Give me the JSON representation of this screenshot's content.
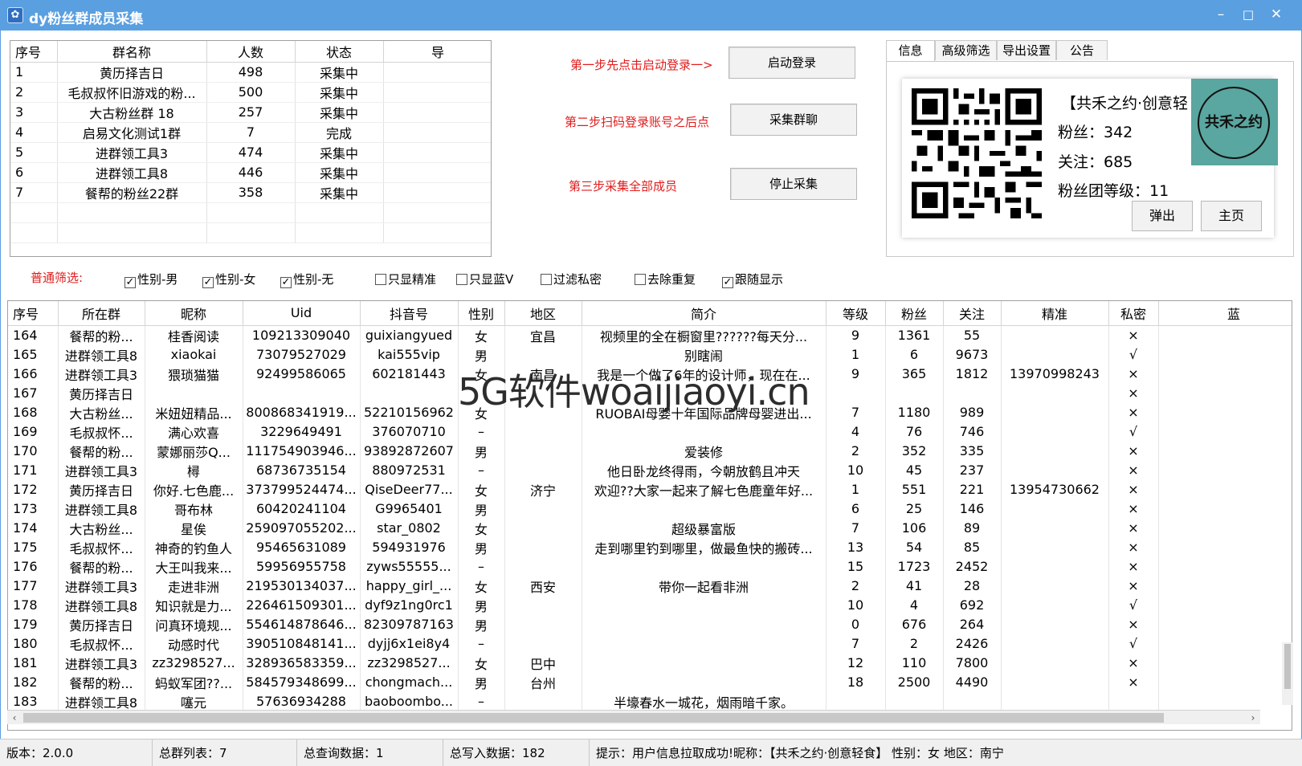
{
  "window": {
    "title": "dy粉丝群成员采集",
    "minimize": "–",
    "maximize": "□",
    "close": "✕"
  },
  "group_table": {
    "columns": [
      "序号",
      "群名称",
      "人数",
      "状态",
      "导"
    ],
    "rows": [
      [
        "1",
        "黄历择吉日",
        "498",
        "采集中"
      ],
      [
        "2",
        "毛叔叔怀旧游戏的粉...",
        "500",
        "采集中"
      ],
      [
        "3",
        "大古粉丝群 18",
        "257",
        "采集中"
      ],
      [
        "4",
        "启易文化测试1群",
        "7",
        "完成"
      ],
      [
        "5",
        "进群领工具3",
        "474",
        "采集中"
      ],
      [
        "6",
        "进群领工具8",
        "446",
        "采集中"
      ],
      [
        "7",
        "餐帮的粉丝22群",
        "358",
        "采集中"
      ]
    ]
  },
  "steps": {
    "step1_label": "第一步先点击启动登录一>",
    "step1_button": "启动登录",
    "step2_label": "第二步扫码登录账号之后点",
    "step2_button": "采集群聊",
    "step3_label": "第三步采集全部成员",
    "step3_button": "停止采集"
  },
  "info_panel": {
    "tabs": [
      "信息",
      "高级筛选",
      "导出设置",
      "公告"
    ],
    "name": "【共禾之约·创意轻",
    "fans": "粉丝：342",
    "following": "关注：685",
    "fan_level": "粉丝团等级：11",
    "logo_text": "共禾之约",
    "eject_button": "弹出",
    "home_button": "主页"
  },
  "filters": {
    "label": "普通筛选:",
    "items": [
      {
        "label": "性别-男",
        "checked": true
      },
      {
        "label": "性别-女",
        "checked": true
      },
      {
        "label": "性别-无",
        "checked": true
      },
      {
        "label": "只显精准",
        "checked": false
      },
      {
        "label": "只显蓝V",
        "checked": false
      },
      {
        "label": "过滤私密",
        "checked": false
      },
      {
        "label": "去除重复",
        "checked": false
      },
      {
        "label": "跟随显示",
        "checked": true
      }
    ]
  },
  "member_table": {
    "columns": [
      "序号",
      "所在群",
      "昵称",
      "Uid",
      "抖音号",
      "性别",
      "地区",
      "简介",
      "等级",
      "粉丝",
      "关注",
      "精准",
      "私密",
      "蓝"
    ],
    "rows": [
      [
        "164",
        "餐帮的粉...",
        "桂香阅读",
        "109213309040",
        "guixiangyued",
        "女",
        "宜昌",
        "视频里的全在橱窗里??????每天分...",
        "9",
        "1361",
        "55",
        "",
        "×"
      ],
      [
        "165",
        "进群领工具8",
        "xiaokai",
        "73079527029",
        "kai555vip",
        "男",
        "",
        "别瞎闹",
        "1",
        "6",
        "9673",
        "",
        "√"
      ],
      [
        "166",
        "进群领工具3",
        "猥琐猫猫",
        "92499586065",
        "602181443",
        "女",
        "南昌",
        "我是一个做了6年的设计师，现在在...",
        "9",
        "365",
        "1812",
        "13970998243",
        "×"
      ],
      [
        "167",
        "黄历择吉日",
        "",
        "",
        "",
        "",
        "",
        "",
        "",
        "",
        "",
        "",
        "×"
      ],
      [
        "168",
        "大古粉丝...",
        "米妞妞精品...",
        "800868341919...",
        "52210156962",
        "女",
        "",
        "RUOBAI母婴十年国际品牌母婴进出...",
        "7",
        "1180",
        "989",
        "",
        "×"
      ],
      [
        "169",
        "毛叔叔怀...",
        "满心欢喜",
        "3229649491",
        "376070710",
        "–",
        "",
        "",
        "4",
        "76",
        "746",
        "",
        "√"
      ],
      [
        "170",
        "餐帮的粉...",
        "蒙娜丽莎Q...",
        "111754903946...",
        "93892872607",
        "男",
        "",
        "爱装修",
        "2",
        "352",
        "335",
        "",
        "×"
      ],
      [
        "171",
        "进群领工具3",
        "樳",
        "68736735154",
        "880972531",
        "–",
        "",
        "他日卧龙终得雨，今朝放鹤且冲天",
        "10",
        "45",
        "237",
        "",
        "×"
      ],
      [
        "172",
        "黄历择吉日",
        "你好.七色鹿...",
        "373799524474...",
        "QiseDeer77...",
        "女",
        "济宁",
        "欢迎??大家一起来了解七色鹿童年好...",
        "1",
        "551",
        "221",
        "13954730662",
        "×"
      ],
      [
        "173",
        "进群领工具8",
        "哥布林",
        "60420241104",
        "G9965401",
        "男",
        "",
        "",
        "6",
        "25",
        "146",
        "",
        "×"
      ],
      [
        "174",
        "大古粉丝...",
        "星俟",
        "259097055202...",
        "star_0802",
        "女",
        "",
        "超级暴富版",
        "7",
        "106",
        "89",
        "",
        "×"
      ],
      [
        "175",
        "毛叔叔怀...",
        "神奇的钓鱼人",
        "95465631089",
        "594931976",
        "男",
        "",
        "走到哪里钓到哪里，做最鱼快的搬砖...",
        "13",
        "54",
        "85",
        "",
        "×"
      ],
      [
        "176",
        "餐帮的粉...",
        "大王叫我来...",
        "59956955758",
        "zyws55555...",
        "–",
        "",
        "",
        "15",
        "1723",
        "2452",
        "",
        "×"
      ],
      [
        "177",
        "进群领工具3",
        "走进非洲",
        "219530134037...",
        "happy_girl_...",
        "女",
        "西安",
        "带你一起看非洲",
        "2",
        "41",
        "28",
        "",
        "×"
      ],
      [
        "178",
        "进群领工具8",
        "知识就是力...",
        "226461509301...",
        "dyf9z1ng0rc1",
        "男",
        "",
        "",
        "10",
        "4",
        "692",
        "",
        "√"
      ],
      [
        "179",
        "黄历择吉日",
        "问真环境规...",
        "554614878646...",
        "82309787163",
        "男",
        "",
        "",
        "0",
        "676",
        "264",
        "",
        "×"
      ],
      [
        "180",
        "毛叔叔怀...",
        "动感时代",
        "390510848141...",
        "dyjj6x1ei8y4",
        "–",
        "",
        "",
        "7",
        "2",
        "2426",
        "",
        "√"
      ],
      [
        "181",
        "进群领工具3",
        "zz3298527...",
        "328936583359...",
        "zz3298527...",
        "女",
        "巴中",
        "",
        "12",
        "110",
        "7800",
        "",
        "×"
      ],
      [
        "182",
        "餐帮的粉...",
        "蚂蚁军团??...",
        "584579348699...",
        "chongmach...",
        "男",
        "台州",
        "",
        "18",
        "2500",
        "4490",
        "",
        "×"
      ],
      [
        "183",
        "进群领工具8",
        "噻元",
        "57636934288",
        "baoboombo...",
        "–",
        "",
        "半壕春水一城花，烟雨暗千家。",
        "",
        "",
        "",
        "",
        ""
      ]
    ]
  },
  "watermark": "5G软件woaijiaoyi.cn",
  "statusbar": {
    "version": "版本：2.0.0",
    "total_groups": "总群列表：7",
    "total_queries": "总查询数据：1",
    "total_written": "总写入数据：182",
    "hint": "提示：用户信息拉取成功!昵称：【共禾之约·创意轻食】 性别：女 地区：南宁"
  }
}
